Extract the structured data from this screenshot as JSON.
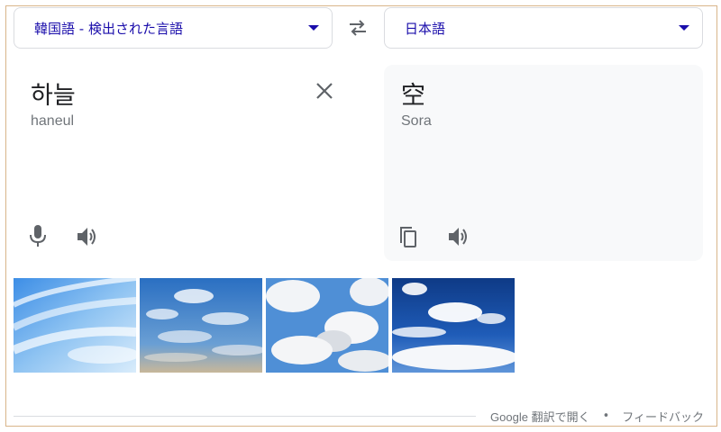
{
  "source_language": {
    "label": "韓国語 - 検出された言語"
  },
  "target_language": {
    "label": "日本語"
  },
  "source": {
    "text": "하늘",
    "transliteration": "haneul"
  },
  "target": {
    "text": "空",
    "transliteration": "Sora"
  },
  "icons": {
    "swap": "swap-icon",
    "clear": "close-icon",
    "mic": "microphone-icon",
    "speaker": "speaker-icon",
    "copy": "copy-icon",
    "dropdown": "chevron-down-icon"
  },
  "colors": {
    "accent": "#1a0dab",
    "icon": "#5f6368",
    "frame": "#d9b58a",
    "target_bg": "#f8f9fa"
  },
  "images": [
    {
      "name": "sky-image-1"
    },
    {
      "name": "sky-image-2"
    },
    {
      "name": "sky-image-3"
    },
    {
      "name": "sky-image-4"
    }
  ],
  "footer": {
    "open_link": "Google 翻訳で開く",
    "separator": "•",
    "feedback_link": "フィードバック"
  }
}
